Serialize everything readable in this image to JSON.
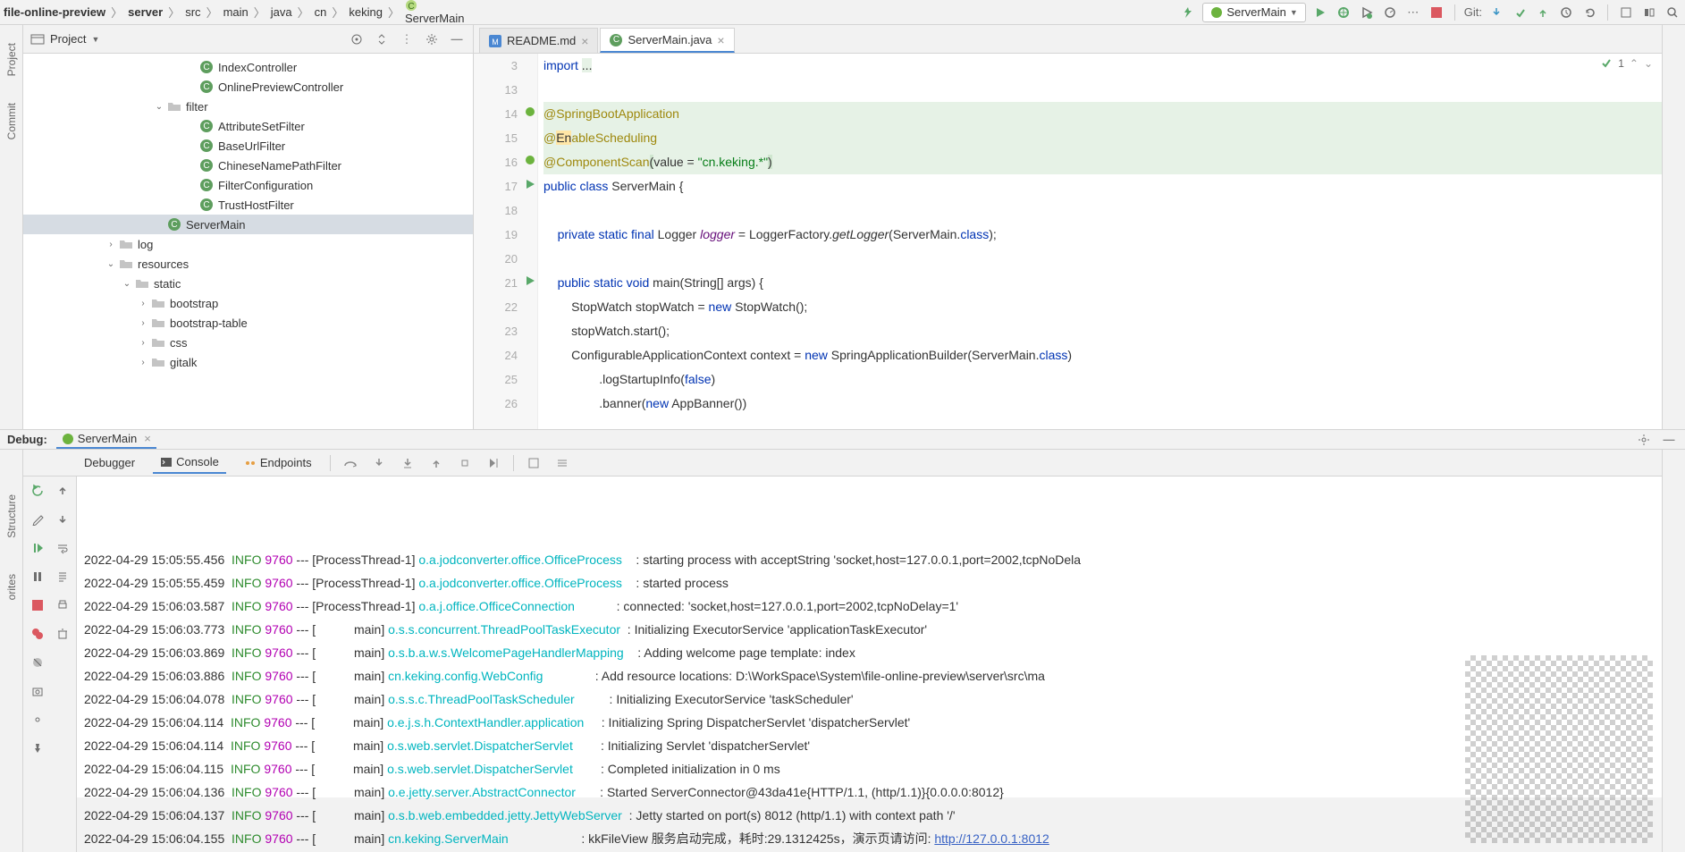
{
  "breadcrumb": [
    "file-online-preview",
    "server",
    "src",
    "main",
    "java",
    "cn",
    "keking",
    "ServerMain"
  ],
  "runConfig": "ServerMain",
  "gitLabel": "Git:",
  "projectLabel": "Project",
  "leftTabs": {
    "commit": "Commit",
    "project": "Project",
    "structure": "Structure",
    "favorites": "orites"
  },
  "tree": [
    {
      "indent": 10,
      "icon": "class",
      "label": "IndexController"
    },
    {
      "indent": 10,
      "icon": "class",
      "label": "OnlinePreviewController"
    },
    {
      "indent": 8,
      "exp": "v",
      "icon": "folder",
      "label": "filter"
    },
    {
      "indent": 10,
      "icon": "class",
      "label": "AttributeSetFilter"
    },
    {
      "indent": 10,
      "icon": "class",
      "label": "BaseUrlFilter"
    },
    {
      "indent": 10,
      "icon": "class",
      "label": "ChineseNamePathFilter"
    },
    {
      "indent": 10,
      "icon": "class",
      "label": "FilterConfiguration"
    },
    {
      "indent": 10,
      "icon": "class",
      "label": "TrustHostFilter"
    },
    {
      "indent": 8,
      "icon": "class",
      "label": "ServerMain",
      "selected": true
    },
    {
      "indent": 5,
      "exp": ">",
      "icon": "folder",
      "label": "log"
    },
    {
      "indent": 5,
      "exp": "v",
      "icon": "folder",
      "label": "resources"
    },
    {
      "indent": 6,
      "exp": "v",
      "icon": "folder",
      "label": "static"
    },
    {
      "indent": 7,
      "exp": ">",
      "icon": "folder",
      "label": "bootstrap"
    },
    {
      "indent": 7,
      "exp": ">",
      "icon": "folder",
      "label": "bootstrap-table"
    },
    {
      "indent": 7,
      "exp": ">",
      "icon": "folder",
      "label": "css"
    },
    {
      "indent": 7,
      "exp": ">",
      "icon": "folder",
      "label": "gitalk"
    }
  ],
  "editorTabs": [
    {
      "icon": "md",
      "label": "README.md",
      "active": false
    },
    {
      "icon": "class",
      "label": "ServerMain.java",
      "active": true
    }
  ],
  "editorBadge": "1",
  "lineStart": 3,
  "code": [
    {
      "n": 3,
      "html": "<span class='kw'>import</span> <span style='background:#e6f2e6'>...</span>"
    },
    {
      "n": 13,
      "html": ""
    },
    {
      "n": 14,
      "bg": true,
      "gicon": "bean",
      "html": "<span class='ann'>@SpringBootApplication</span>"
    },
    {
      "n": 15,
      "bg": true,
      "html": "<span class='ann'>@</span><span style='background:#ffe6a6'>En</span><span class='ann'>ableScheduling</span>"
    },
    {
      "n": 16,
      "bg": true,
      "gicon": "bean",
      "html": "<span class='ann'>@ComponentScan</span><span style='background:#cfe6cf'>(</span>value = <span class='str'>\"cn.keking.*\"</span><span style='background:#cfe6cf'>)</span>"
    },
    {
      "n": 17,
      "gicon": "run",
      "html": "<span class='kw'>public class</span> ServerMain {"
    },
    {
      "n": 18,
      "html": ""
    },
    {
      "n": 19,
      "html": "    <span class='kw'>private static final</span> Logger <span class='id-static'>logger</span> = LoggerFactory.<span class='mth-static'>getLogger</span>(ServerMain.<span class='kw'>class</span>);"
    },
    {
      "n": 20,
      "html": ""
    },
    {
      "n": 21,
      "gicon": "run",
      "html": "    <span class='kw'>public static void</span> main(String[] args) {"
    },
    {
      "n": 22,
      "html": "        StopWatch stopWatch = <span class='kw'>new</span> StopWatch();"
    },
    {
      "n": 23,
      "html": "        stopWatch.start();"
    },
    {
      "n": 24,
      "html": "        ConfigurableApplicationContext context = <span class='kw'>new</span> SpringApplicationBuilder(ServerMain.<span class='kw'>class</span>)"
    },
    {
      "n": 25,
      "html": "                .logStartupInfo(<span class='kw'>false</span>)"
    },
    {
      "n": 26,
      "html": "                .banner(<span class='kw'>new</span> AppBanner())"
    }
  ],
  "debugTitle": "Debug:",
  "debugConfig": "ServerMain",
  "debugTabs": {
    "debugger": "Debugger",
    "console": "Console",
    "endpoints": "Endpoints"
  },
  "logs": [
    {
      "ts": "2022-04-29 15:05:55.456",
      "lvl": "INFO",
      "pid": "9760",
      "thr": "[ProcessThread-1]",
      "cls": "o.a.jodconverter.office.OfficeProcess",
      "msg": ": starting process with acceptString 'socket,host=127.0.0.1,port=2002,tcpNoDela"
    },
    {
      "ts": "2022-04-29 15:05:55.459",
      "lvl": "INFO",
      "pid": "9760",
      "thr": "[ProcessThread-1]",
      "cls": "o.a.jodconverter.office.OfficeProcess",
      "msg": ": started process"
    },
    {
      "ts": "2022-04-29 15:06:03.587",
      "lvl": "INFO",
      "pid": "9760",
      "thr": "[ProcessThread-1]",
      "cls": "o.a.j.office.OfficeConnection",
      "msg": ": connected: 'socket,host=127.0.0.1,port=2002,tcpNoDelay=1'"
    },
    {
      "ts": "2022-04-29 15:06:03.773",
      "lvl": "INFO",
      "pid": "9760",
      "thr": "[           main]",
      "cls": "o.s.s.concurrent.ThreadPoolTaskExecutor",
      "msg": ": Initializing ExecutorService 'applicationTaskExecutor'"
    },
    {
      "ts": "2022-04-29 15:06:03.869",
      "lvl": "INFO",
      "pid": "9760",
      "thr": "[           main]",
      "cls": "o.s.b.a.w.s.WelcomePageHandlerMapping",
      "msg": ": Adding welcome page template: index"
    },
    {
      "ts": "2022-04-29 15:06:03.886",
      "lvl": "INFO",
      "pid": "9760",
      "thr": "[           main]",
      "cls": "cn.keking.config.WebConfig",
      "msg": ": Add resource locations: D:\\WorkSpace\\System\\file-online-preview\\server\\src\\ma"
    },
    {
      "ts": "2022-04-29 15:06:04.078",
      "lvl": "INFO",
      "pid": "9760",
      "thr": "[           main]",
      "cls": "o.s.s.c.ThreadPoolTaskScheduler",
      "msg": ": Initializing ExecutorService 'taskScheduler'"
    },
    {
      "ts": "2022-04-29 15:06:04.114",
      "lvl": "INFO",
      "pid": "9760",
      "thr": "[           main]",
      "cls": "o.e.j.s.h.ContextHandler.application",
      "msg": ": Initializing Spring DispatcherServlet 'dispatcherServlet'"
    },
    {
      "ts": "2022-04-29 15:06:04.114",
      "lvl": "INFO",
      "pid": "9760",
      "thr": "[           main]",
      "cls": "o.s.web.servlet.DispatcherServlet",
      "msg": ": Initializing Servlet 'dispatcherServlet'"
    },
    {
      "ts": "2022-04-29 15:06:04.115",
      "lvl": "INFO",
      "pid": "9760",
      "thr": "[           main]",
      "cls": "o.s.web.servlet.DispatcherServlet",
      "msg": ": Completed initialization in 0 ms"
    },
    {
      "ts": "2022-04-29 15:06:04.136",
      "lvl": "INFO",
      "pid": "9760",
      "thr": "[           main]",
      "cls": "o.e.jetty.server.AbstractConnector",
      "msg": ": Started ServerConnector@43da41e{HTTP/1.1, (http/1.1)}{0.0.0.0:8012}"
    },
    {
      "ts": "2022-04-29 15:06:04.137",
      "lvl": "INFO",
      "pid": "9760",
      "thr": "[           main]",
      "cls": "o.s.b.web.embedded.jetty.JettyWebServer",
      "msg": ": Jetty started on port(s) 8012 (http/1.1) with context path '/'"
    },
    {
      "ts": "2022-04-29 15:06:04.155",
      "lvl": "INFO",
      "pid": "9760",
      "thr": "[           main]",
      "cls": "cn.keking.ServerMain",
      "msg": ": kkFileView 服务启动完成，耗时:29.1312425s，演示页请访问: ",
      "link": "http://127.0.0.1:8012"
    }
  ]
}
